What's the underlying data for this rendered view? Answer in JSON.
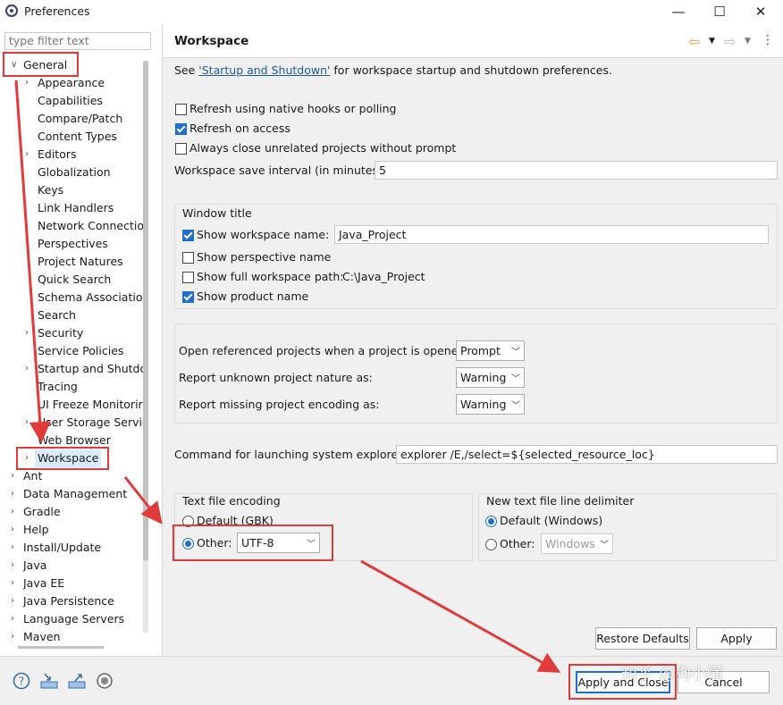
{
  "window": {
    "title": "Preferences",
    "minimize": "—",
    "maximize": "☐",
    "close": "✕"
  },
  "sidebar": {
    "filter_placeholder": "type filter text",
    "general": "General",
    "general_children": [
      "Appearance",
      "Capabilities",
      "Compare/Patch",
      "Content Types",
      "Editors",
      "Globalization",
      "Keys",
      "Link Handlers",
      "Network Connectio",
      "Perspectives",
      "Project Natures",
      "Quick Search",
      "Schema Associatior",
      "Search",
      "Security",
      "Service Policies",
      "Startup and Shutdo",
      "Tracing",
      "UI Freeze Monitorir",
      "User Storage Servic",
      "Web Browser",
      "Workspace"
    ],
    "top_level": [
      "Ant",
      "Data Management",
      "Gradle",
      "Help",
      "Install/Update",
      "Java",
      "Java EE",
      "Java Persistence",
      "Language Servers",
      "Maven"
    ]
  },
  "page": {
    "title": "Workspace",
    "see_prefix": "See ",
    "see_link": "'Startup and Shutdown'",
    "see_suffix": " for workspace startup and shutdown preferences.",
    "refresh_native": "Refresh using native hooks or polling",
    "refresh_access": "Refresh on access",
    "always_close": "Always close unrelated projects without prompt",
    "save_interval_label": "Workspace save interval (in minutes):",
    "save_interval_value": "5",
    "window_title_group": "Window title",
    "show_ws_name": "Show workspace name:",
    "ws_name_value": "Java_Project",
    "show_perspective": "Show perspective name",
    "show_full_path": "Show full workspace path:",
    "full_path_value": "C:\\Java_Project",
    "show_product": "Show product name",
    "open_ref_label": "Open referenced projects when a project is opened:",
    "open_ref_value": "Prompt",
    "unknown_nature_label": "Report unknown project nature as:",
    "unknown_nature_value": "Warning",
    "missing_enc_label": "Report missing project encoding as:",
    "missing_enc_value": "Warning",
    "cmd_label": "Command for launching system explorer:",
    "cmd_value": "explorer /E,/select=${selected_resource_loc}",
    "text_enc_group": "Text file encoding",
    "default_enc": "Default (GBK)",
    "other_label": "Other:",
    "other_enc_value": "UTF-8",
    "line_delim_group": "New text file line delimiter",
    "default_delim": "Default (Windows)",
    "other_delim_label": "Other:",
    "other_delim_value": "Windows",
    "restore_defaults": "Restore Defaults",
    "apply": "Apply"
  },
  "footer": {
    "apply_close": "Apply and Close",
    "cancel": "Cancel",
    "watermark": "知乎 @狗小懂"
  },
  "colors": {
    "accent": "#1e6fd0",
    "annotation": "#e13a3a",
    "link": "#1e5ba8"
  }
}
